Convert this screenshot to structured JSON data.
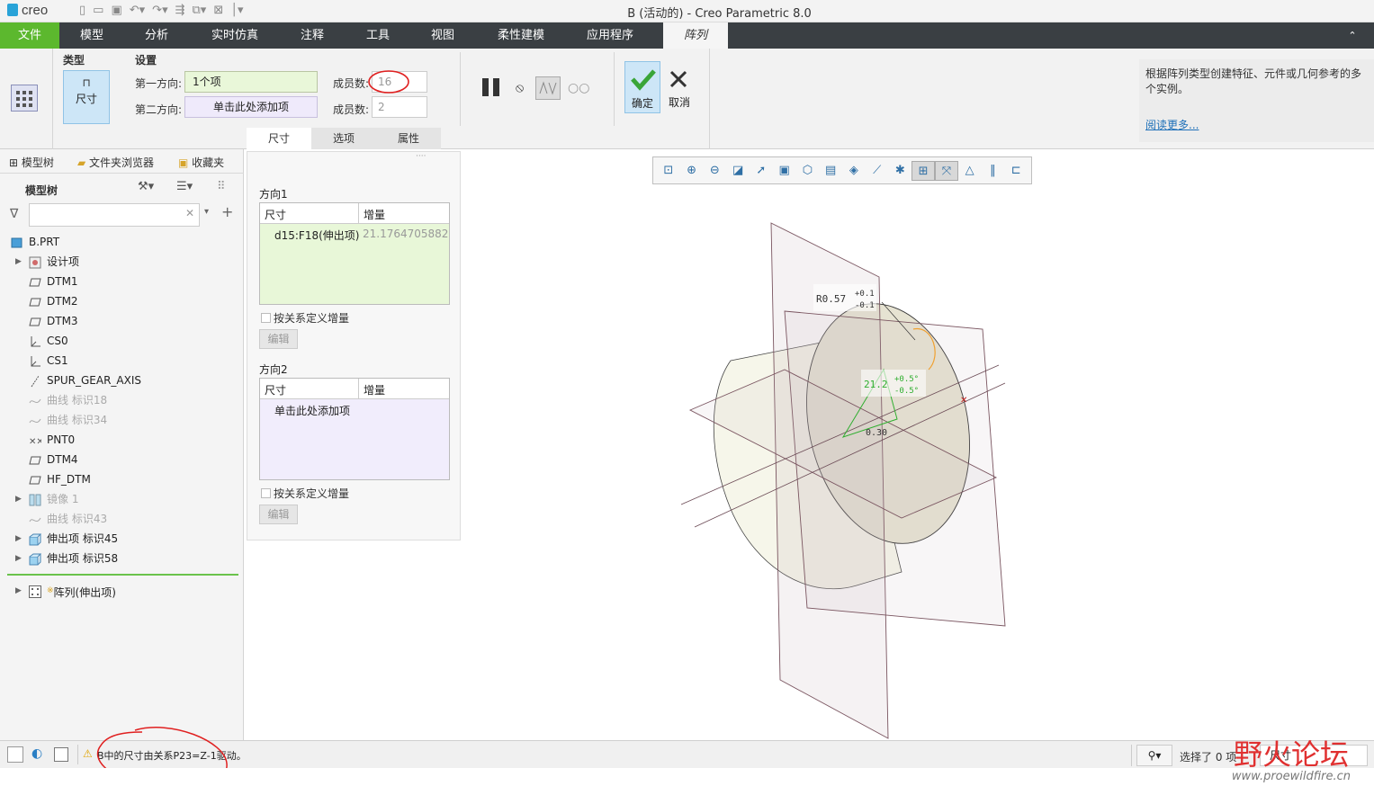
{
  "app": {
    "logo": "creo",
    "title": "B (活动的) - Creo Parametric 8.0"
  },
  "menubar": {
    "file": "文件",
    "items": [
      "模型",
      "分析",
      "实时仿真",
      "注释",
      "工具",
      "视图",
      "柔性建模",
      "应用程序"
    ],
    "active_tab": "阵列"
  },
  "ribbon": {
    "type_group": "类型",
    "type_value": "尺寸",
    "settings_group": "设置",
    "dir1_label": "第一方向:",
    "dir1_value": "1个项",
    "dir2_label": "第二方向:",
    "dir2_value": "单击此处添加项",
    "members1_label": "成员数:",
    "members1_value": "16",
    "members2_label": "成员数:",
    "members2_value": "2",
    "ok": "确定",
    "cancel": "取消",
    "tabs": [
      "尺寸",
      "选项",
      "属性"
    ],
    "help_text": "根据阵列类型创建特征、元件或几何参考的多个实例。",
    "help_link": "阅读更多..."
  },
  "leftpanel": {
    "tabs": [
      "模型树",
      "文件夹浏览器",
      "收藏夹"
    ],
    "header": "模型树",
    "search_placeholder": "",
    "tree": [
      {
        "label": "B.PRT",
        "icon": "part-icon",
        "arrow": false,
        "dim": false
      },
      {
        "label": "设计项",
        "icon": "design-items-icon",
        "arrow": true,
        "dim": false
      },
      {
        "label": "DTM1",
        "icon": "datum-plane-icon",
        "arrow": false,
        "dim": false
      },
      {
        "label": "DTM2",
        "icon": "datum-plane-icon",
        "arrow": false,
        "dim": false
      },
      {
        "label": "DTM3",
        "icon": "datum-plane-icon",
        "arrow": false,
        "dim": false
      },
      {
        "label": "CS0",
        "icon": "coordinate-system-icon",
        "arrow": false,
        "dim": false
      },
      {
        "label": "CS1",
        "icon": "coordinate-system-icon",
        "arrow": false,
        "dim": false
      },
      {
        "label": "SPUR_GEAR_AXIS",
        "icon": "axis-icon",
        "arrow": false,
        "dim": false
      },
      {
        "label": "曲线 标识18",
        "icon": "curve-icon",
        "arrow": false,
        "dim": true
      },
      {
        "label": "曲线 标识34",
        "icon": "curve-icon",
        "arrow": false,
        "dim": true
      },
      {
        "label": "PNT0",
        "icon": "datum-point-icon",
        "arrow": false,
        "dim": false
      },
      {
        "label": "DTM4",
        "icon": "datum-plane-icon",
        "arrow": false,
        "dim": false
      },
      {
        "label": "HF_DTM",
        "icon": "datum-plane-icon",
        "arrow": false,
        "dim": false
      },
      {
        "label": "镜像 1",
        "icon": "mirror-icon",
        "arrow": true,
        "dim": true
      },
      {
        "label": "曲线 标识43",
        "icon": "curve-icon",
        "arrow": false,
        "dim": true
      },
      {
        "label": "伸出项 标识45",
        "icon": "extrude-icon",
        "arrow": true,
        "dim": false
      },
      {
        "label": "伸出项 标识58",
        "icon": "extrude-icon",
        "arrow": true,
        "dim": false
      }
    ],
    "pattern_node": "阵列(伸出项)",
    "pattern_marker": "※"
  },
  "midpanel": {
    "dir1_title": "方向1",
    "col_dim": "尺寸",
    "col_inc": "增量",
    "dir1_row_dim": "d15:F18(伸出项)",
    "dir1_row_inc": "21.1764705882",
    "relation_check": "按关系定义增量",
    "edit": "编辑",
    "dir2_title": "方向2",
    "dir2_placeholder": "单击此处添加项"
  },
  "graphics": {
    "dim_radius": "R0.57",
    "dim_tol_plus": "+0.1",
    "dim_tol_minus": "-0.1",
    "dim_angle": "21.2",
    "dim_angle_plus": "+0.5°",
    "dim_angle_minus": "-0.5°",
    "dim_small": "0.30"
  },
  "statusbar": {
    "message": "B中的尺寸由关系P23=Z-1驱动。",
    "selection": "选择了 0 项",
    "filter": "尺寸"
  },
  "watermark": {
    "text": "野火论坛",
    "url": "www.proewildfire.cn"
  }
}
